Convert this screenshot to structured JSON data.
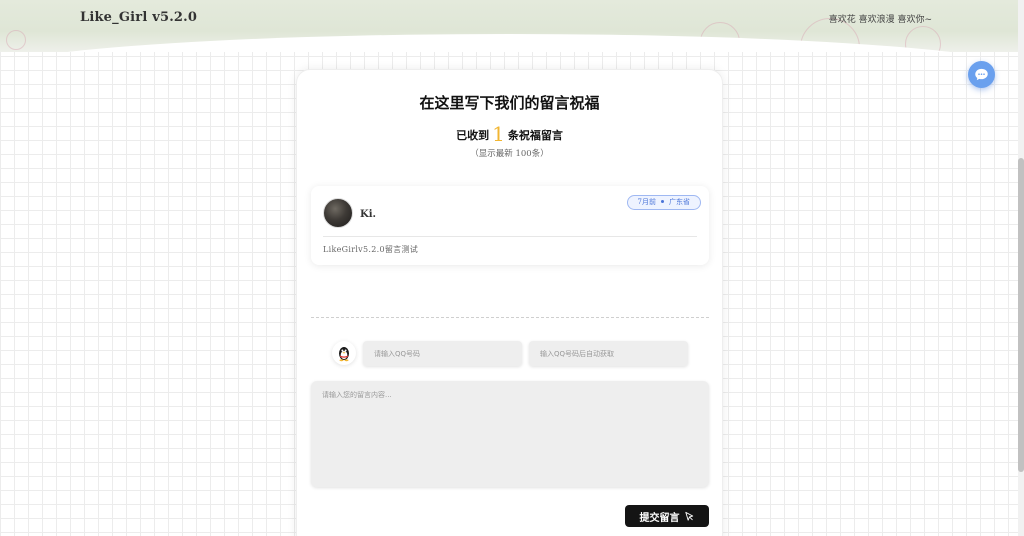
{
  "header": {
    "brand": "Like_Girl v5.2.0",
    "links": "喜欢花 喜欢浪漫 喜欢你~"
  },
  "icons": {
    "chat": "chat-bubble-icon",
    "qq": "qq-penguin-icon",
    "send": "pointer-icon"
  },
  "colors": {
    "accent_number": "#f2b632",
    "chat_button": "#6aa0ee",
    "tag_blue": "#4a74d8",
    "submit_bg": "#141414"
  },
  "board": {
    "title": "在这里写下我们的留言祝福",
    "count_prefix": "已收到",
    "count": "1",
    "count_suffix": "条祝福留言",
    "subtitle": "（显示最新 100条）"
  },
  "messages": [
    {
      "name": "Ki.",
      "time": "7月前",
      "location": "广东省",
      "text": "LikeGirlv5.2.0留言测试"
    }
  ],
  "form": {
    "qq_placeholder": "请输入QQ号码",
    "nickname_placeholder": "输入QQ号码后自动获取",
    "content_placeholder": "请输入您的留言内容...",
    "submit_label": "提交留言"
  }
}
